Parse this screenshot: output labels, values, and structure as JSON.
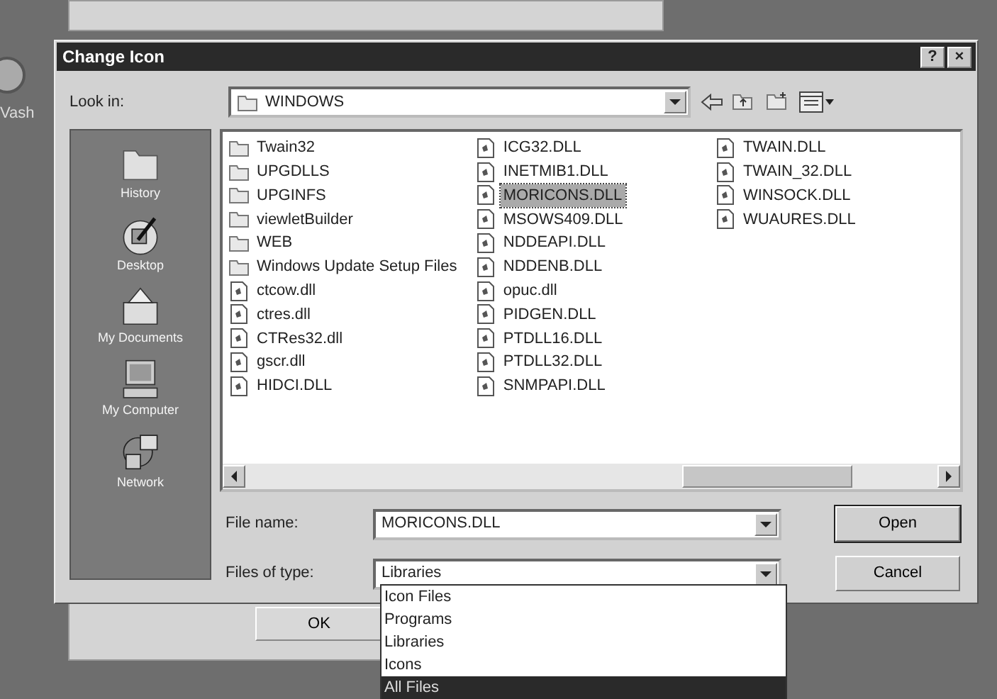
{
  "desktop": {
    "icon_label": "Vash"
  },
  "background_window": {
    "button": "OK"
  },
  "dialog": {
    "title": "Change Icon",
    "help_button": "?",
    "close_button": "×",
    "look_in": {
      "label": "Look in:",
      "value": "WINDOWS"
    },
    "places": [
      {
        "label": "History",
        "kind": "history"
      },
      {
        "label": "Desktop",
        "kind": "desktop"
      },
      {
        "label": "My Documents",
        "kind": "documents"
      },
      {
        "label": "My Computer",
        "kind": "computer"
      },
      {
        "label": "Network",
        "kind": "network"
      }
    ],
    "files": [
      [
        {
          "name": "Twain32",
          "kind": "folder",
          "selected": false
        },
        {
          "name": "UPGDLLS",
          "kind": "folder",
          "selected": false
        },
        {
          "name": "UPGINFS",
          "kind": "folder",
          "selected": false
        },
        {
          "name": "viewletBuilder",
          "kind": "folder",
          "selected": false
        },
        {
          "name": "WEB",
          "kind": "folder",
          "selected": false
        },
        {
          "name": "Windows Update Setup Files",
          "kind": "folder",
          "selected": false
        },
        {
          "name": "ctcow.dll",
          "kind": "file",
          "selected": false
        },
        {
          "name": "ctres.dll",
          "kind": "file",
          "selected": false
        },
        {
          "name": "CTRes32.dll",
          "kind": "file",
          "selected": false
        },
        {
          "name": "gscr.dll",
          "kind": "file",
          "selected": false
        },
        {
          "name": "HIDCI.DLL",
          "kind": "file",
          "selected": false
        }
      ],
      [
        {
          "name": "ICG32.DLL",
          "kind": "file",
          "selected": false
        },
        {
          "name": "INETMIB1.DLL",
          "kind": "file",
          "selected": false
        },
        {
          "name": "MORICONS.DLL",
          "kind": "file",
          "selected": true
        },
        {
          "name": "MSOWS409.DLL",
          "kind": "file",
          "selected": false
        },
        {
          "name": "NDDEAPI.DLL",
          "kind": "file",
          "selected": false
        },
        {
          "name": "NDDENB.DLL",
          "kind": "file",
          "selected": false
        },
        {
          "name": "opuc.dll",
          "kind": "file",
          "selected": false
        },
        {
          "name": "PIDGEN.DLL",
          "kind": "file",
          "selected": false
        },
        {
          "name": "PTDLL16.DLL",
          "kind": "file",
          "selected": false
        },
        {
          "name": "PTDLL32.DLL",
          "kind": "file",
          "selected": false
        },
        {
          "name": "SNMPAPI.DLL",
          "kind": "file",
          "selected": false
        }
      ],
      [
        {
          "name": "TWAIN.DLL",
          "kind": "file",
          "selected": false
        },
        {
          "name": "TWAIN_32.DLL",
          "kind": "file",
          "selected": false
        },
        {
          "name": "WINSOCK.DLL",
          "kind": "file",
          "selected": false
        },
        {
          "name": "WUAURES.DLL",
          "kind": "file",
          "selected": false
        }
      ]
    ],
    "file_name": {
      "label": "File name:",
      "value": "MORICONS.DLL"
    },
    "files_of_type": {
      "label": "Files of type:",
      "value": "Libraries",
      "expanded": true,
      "options": [
        {
          "label": "Icon Files",
          "highlighted": false
        },
        {
          "label": "Programs",
          "highlighted": false
        },
        {
          "label": "Libraries",
          "highlighted": false
        },
        {
          "label": "Icons",
          "highlighted": false
        },
        {
          "label": "All Files",
          "highlighted": true
        }
      ]
    },
    "buttons": [
      {
        "label": "Open",
        "default": true
      },
      {
        "label": "Cancel",
        "default": false
      }
    ]
  }
}
